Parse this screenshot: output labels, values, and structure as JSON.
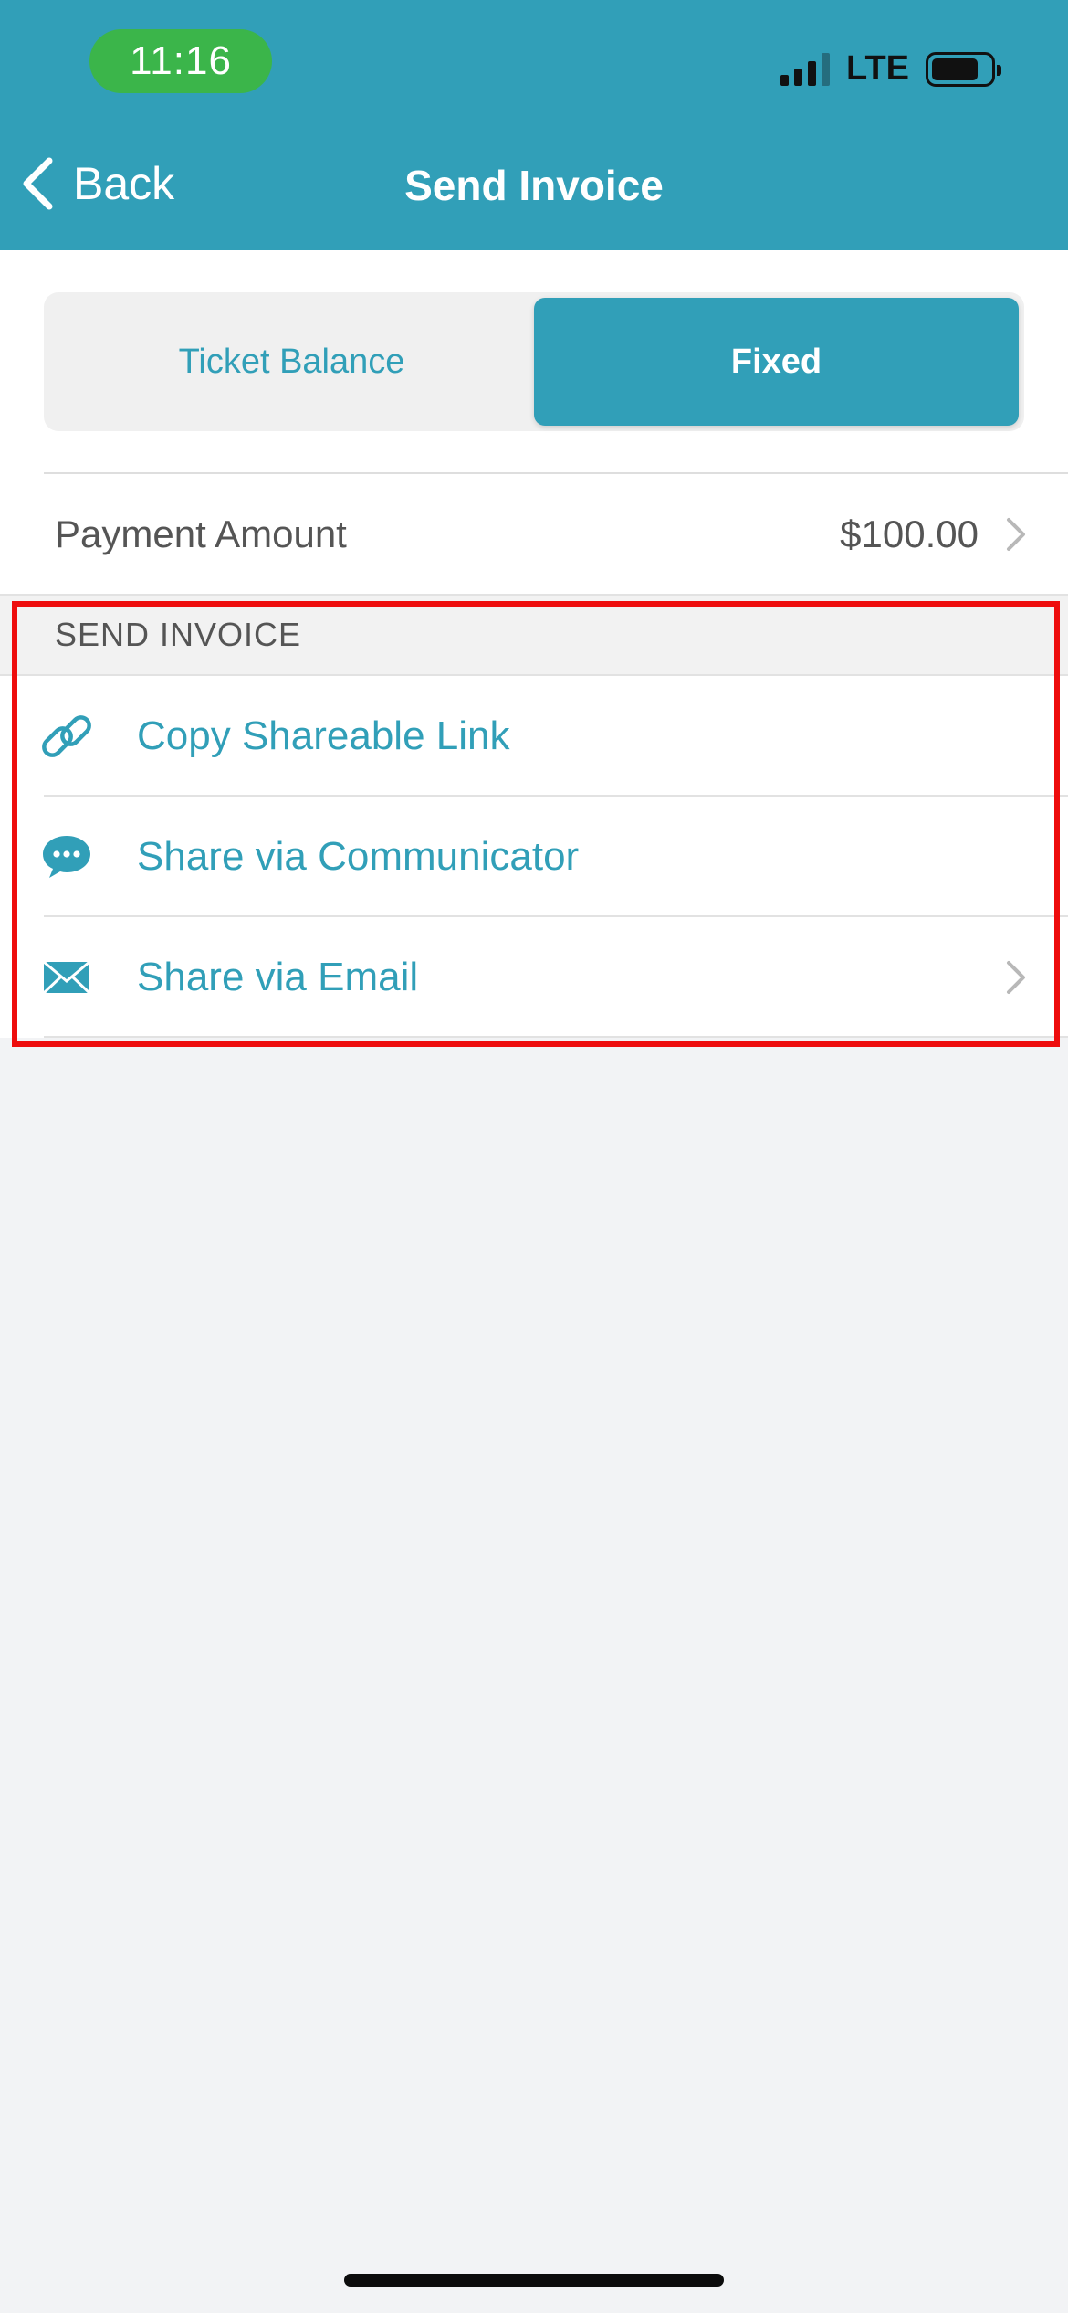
{
  "status_bar": {
    "time": "11:16",
    "network": "LTE"
  },
  "nav": {
    "back_label": "Back",
    "title": "Send Invoice"
  },
  "segment": {
    "options": [
      "Ticket Balance",
      "Fixed"
    ],
    "selected": "Fixed"
  },
  "payment": {
    "label": "Payment Amount",
    "value": "$100.00"
  },
  "section": {
    "header": "SEND INVOICE",
    "items": [
      {
        "label": "Copy Shareable Link",
        "icon": "link-icon"
      },
      {
        "label": "Share via Communicator",
        "icon": "chat-bubble-icon"
      },
      {
        "label": "Share via Email",
        "icon": "envelope-icon"
      }
    ]
  },
  "colors": {
    "accent": "#319fb8",
    "highlight": "#ee0d0d",
    "time_pill": "#3bb54a"
  }
}
